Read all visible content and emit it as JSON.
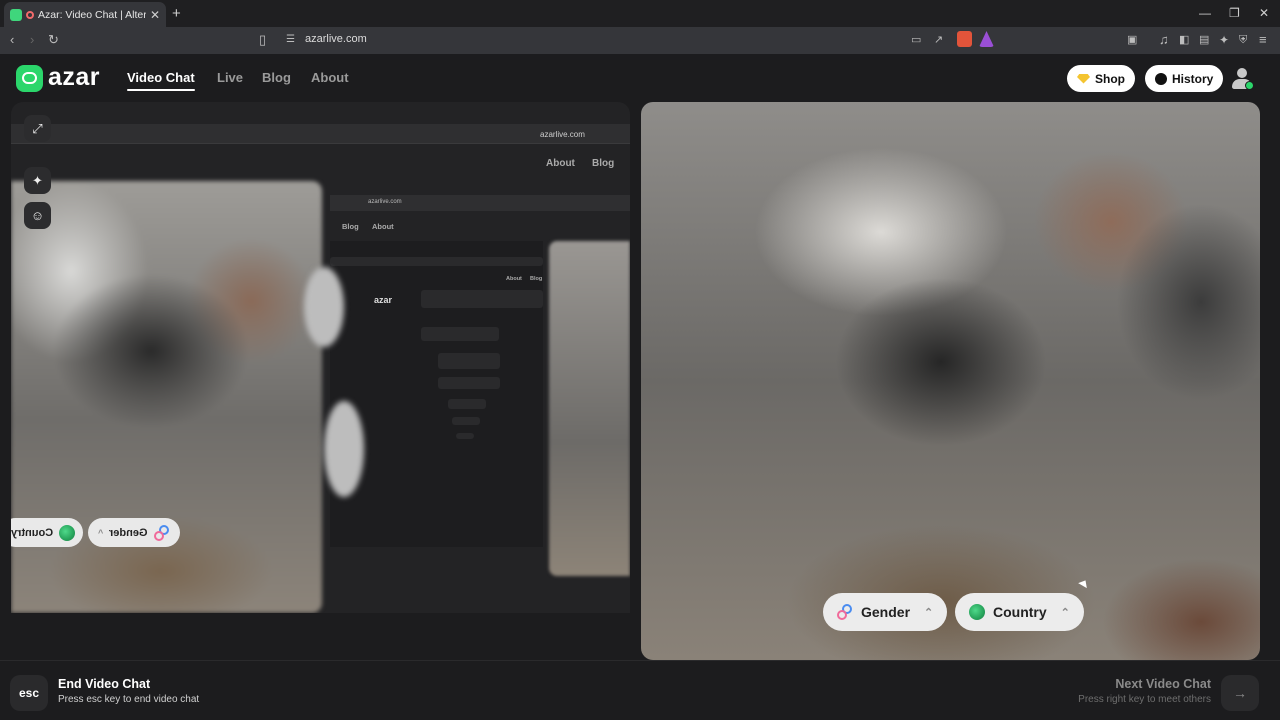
{
  "browser": {
    "tab_title": "Azar: Video Chat | Alternative",
    "new_tab": "+",
    "url": "azarlive.com",
    "window_controls": {
      "minimize": "—",
      "restore": "❐",
      "close": "✕"
    }
  },
  "site": {
    "logo_text": "azar",
    "nav": [
      {
        "label": "Video Chat",
        "active": true
      },
      {
        "label": "Live",
        "active": false
      },
      {
        "label": "Blog",
        "active": false
      },
      {
        "label": "About",
        "active": false
      }
    ],
    "shop_label": "Shop",
    "history_label": "History"
  },
  "self_view": {
    "mirrored_url": "azarlive.com",
    "mirrored_nav": [
      "Blog",
      "About"
    ],
    "nested_url": "azarlive.com",
    "nested_nav": [
      "Blog",
      "About"
    ],
    "nested_inner_nav": [
      "Blog",
      "About"
    ],
    "nested_logo": "azar",
    "mirrored_chips": {
      "gender": "Gender",
      "country": "Country"
    }
  },
  "filters": {
    "gender_label": "Gender",
    "country_label": "Country"
  },
  "bottom_bar": {
    "esc_key": "esc",
    "end_title": "End Video Chat",
    "end_sub": "Press esc key to end video chat",
    "next_title": "Next Video Chat",
    "next_sub": "Press right key to meet others",
    "next_arrow": "→"
  },
  "colors": {
    "brand_green": "#2bd66b",
    "background": "#1c1c1e",
    "gem": "#f4c430"
  }
}
